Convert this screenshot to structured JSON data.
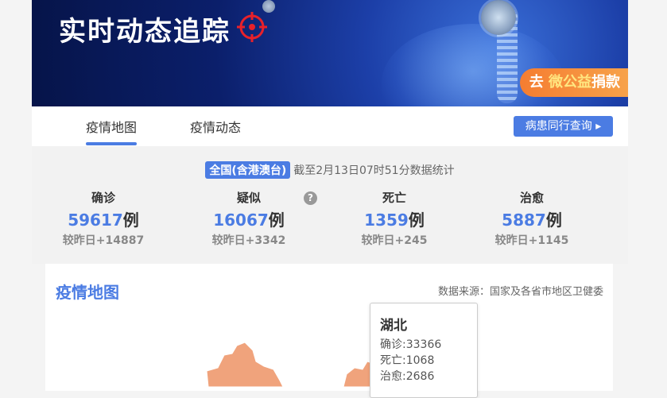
{
  "banner": {
    "title": "实时动态追踪",
    "donate": {
      "prefix": "去",
      "brand": "微公益",
      "suffix": "捐款"
    }
  },
  "tabs": [
    {
      "label": "疫情地图",
      "active": true
    },
    {
      "label": "疫情动态",
      "active": false
    }
  ],
  "query_button": "病患同行查询 ▸",
  "summary": {
    "scope": "全国(含港澳台)",
    "timestamp": "截至2月13日07时51分数据统计",
    "stats": [
      {
        "label": "确诊",
        "value": "59617",
        "unit": "例",
        "delta": "较昨日+14887"
      },
      {
        "label": "疑似",
        "value": "16067",
        "unit": "例",
        "delta": "较昨日+3342"
      },
      {
        "label": "死亡",
        "value": "1359",
        "unit": "例",
        "delta": "较昨日+245"
      },
      {
        "label": "治愈",
        "value": "5887",
        "unit": "例",
        "delta": "较昨日+1145"
      }
    ],
    "help_icon": "?"
  },
  "map": {
    "title": "疫情地图",
    "source": "数据来源：国家及各省市地区卫健委",
    "tooltip": {
      "province": "湖北",
      "confirmed": "确诊:33366",
      "deaths": "死亡:1068",
      "cured": "治愈:2686"
    }
  },
  "colors": {
    "accent": "#4b7ce3",
    "map_fill": "#f0a37c",
    "donate": "#f57d31"
  }
}
